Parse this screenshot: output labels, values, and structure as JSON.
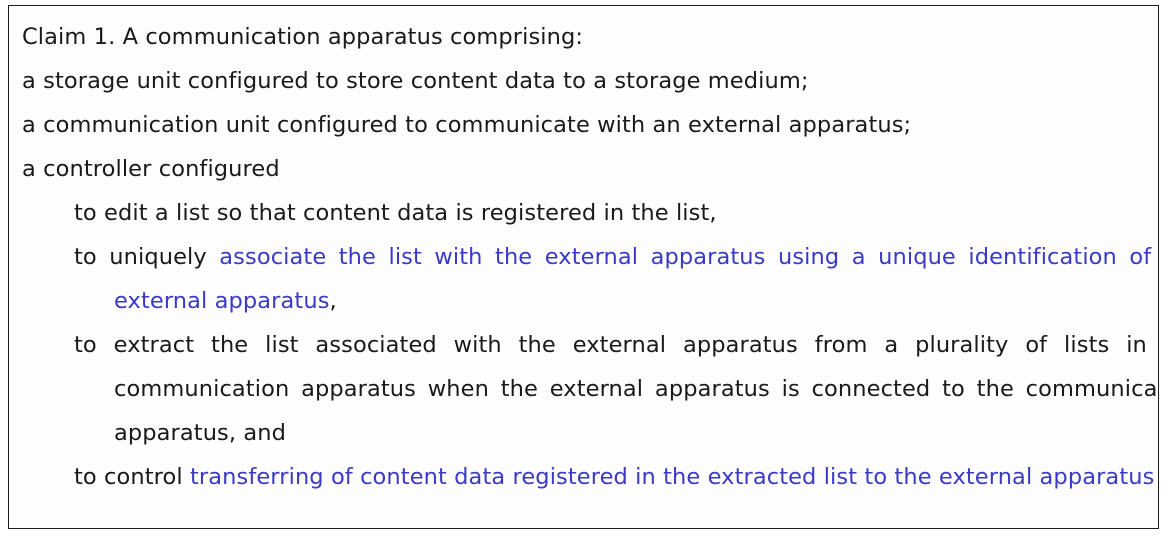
{
  "document": {
    "kind": "patent-claim",
    "colors": {
      "text": "#1a1a1a",
      "highlight": "#3a3ac6",
      "border": "#1b1b1b",
      "background": "#fdfdfd"
    },
    "preamble_lines": [
      "Claim 1. A communication apparatus comprising:",
      "a storage unit configured to store content data to a storage medium;",
      "a communication unit configured to communicate with an external apparatus;",
      "a controller configured"
    ],
    "clauses": [
      {
        "id": "clause-edit-list",
        "plain_prefix": "to edit a list so that content data is registered in the list,",
        "highlight": "",
        "plain_suffix": "",
        "wraps": false
      },
      {
        "id": "clause-associate-list",
        "plain_prefix": "to uniquely ",
        "highlight": "associate the list with the external apparatus using a unique identification of the external apparatus",
        "plain_suffix": ",",
        "wraps": true
      },
      {
        "id": "clause-extract-list",
        "plain_prefix": "to extract the list associated with the external apparatus from a plurality of lists in the communication apparatus when the external apparatus is connected to the communication apparatus, and",
        "highlight": "",
        "plain_suffix": "",
        "wraps": true
      },
      {
        "id": "clause-control-transfer",
        "plain_prefix": "to control ",
        "highlight": "transferring of content data registered in the extracted list to the external apparatus",
        "plain_suffix": "",
        "wraps": true
      }
    ]
  }
}
